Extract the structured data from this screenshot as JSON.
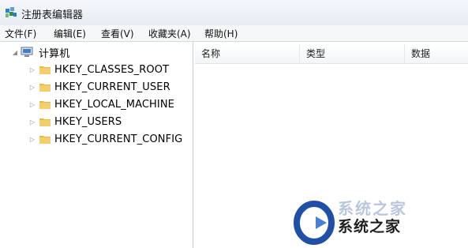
{
  "window": {
    "title": "注册表编辑器",
    "icon": "registry-editor-icon"
  },
  "menubar": {
    "items": [
      "文件(F)",
      "编辑(E)",
      "查看(V)",
      "收藏夹(A)",
      "帮助(H)"
    ]
  },
  "tree": {
    "root": {
      "label": "计算机",
      "icon": "computer-icon",
      "expanded": true
    },
    "children": [
      {
        "label": "HKEY_CLASSES_ROOT",
        "icon": "folder-icon",
        "expanded": false
      },
      {
        "label": "HKEY_CURRENT_USER",
        "icon": "folder-icon",
        "expanded": false
      },
      {
        "label": "HKEY_LOCAL_MACHINE",
        "icon": "folder-icon",
        "expanded": false
      },
      {
        "label": "HKEY_USERS",
        "icon": "folder-icon",
        "expanded": false
      },
      {
        "label": "HKEY_CURRENT_CONFIG",
        "icon": "folder-icon",
        "expanded": false
      }
    ]
  },
  "list": {
    "columns": [
      "名称",
      "类型",
      "数据"
    ]
  },
  "watermark": {
    "text": "系统之家",
    "ghost_text": "系统之家"
  },
  "colors": {
    "folder": "#e8b84a",
    "titlebar": "#eef1f6",
    "watermark_logo": "#1f4fa6"
  }
}
